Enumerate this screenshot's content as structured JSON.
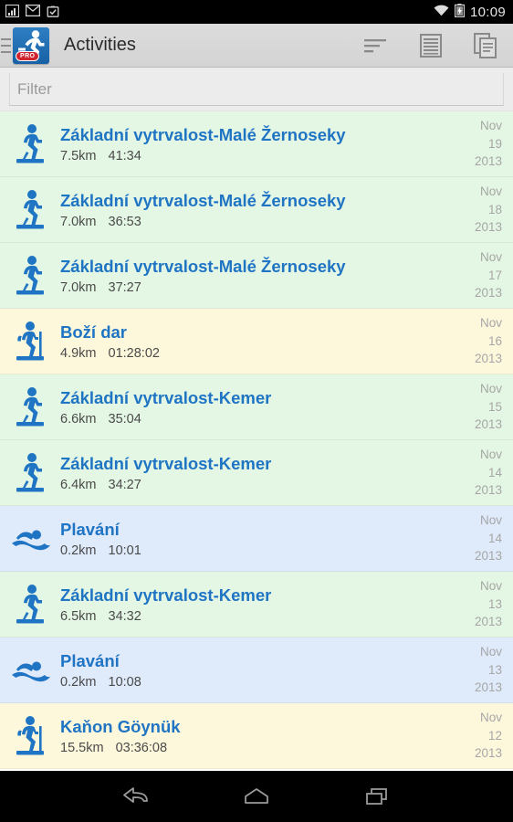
{
  "statusbar": {
    "time": "10:09",
    "left_icons": [
      "signal-bars-icon",
      "gmail-icon",
      "tasks-check-icon"
    ],
    "right_icons": [
      "wifi-icon",
      "battery-charging-icon"
    ]
  },
  "actionbar": {
    "drawer_label": "drawer-handle",
    "app_icon_name": "runtastic-pro-app-icon",
    "pro_badge": "PRO",
    "title": "Activities",
    "actions": [
      {
        "name": "sort-icon",
        "label": "Sort"
      },
      {
        "name": "list-view-icon",
        "label": "List view"
      },
      {
        "name": "copy-pages-icon",
        "label": "Copy"
      }
    ]
  },
  "search": {
    "placeholder": "Filter",
    "value": ""
  },
  "colors": {
    "accent_blue": "#1f74c4",
    "row_green": "#e4f7e4",
    "row_yellow": "#fdf8dc",
    "row_blue": "#dfeafb",
    "date_gray": "#a6a6a6"
  },
  "activities": [
    {
      "icon": "skiing-icon",
      "type": "green",
      "title": "Základní vytrvalost-Malé Žernoseky",
      "distance": "7.5km",
      "duration": "41:34",
      "month": "Nov",
      "day": "19",
      "year": "2013"
    },
    {
      "icon": "skiing-icon",
      "type": "green",
      "title": "Základní vytrvalost-Malé Žernoseky",
      "distance": "7.0km",
      "duration": "36:53",
      "month": "Nov",
      "day": "18",
      "year": "2013"
    },
    {
      "icon": "skiing-icon",
      "type": "green",
      "title": "Základní vytrvalost-Malé Žernoseky",
      "distance": "7.0km",
      "duration": "37:27",
      "month": "Nov",
      "day": "17",
      "year": "2013"
    },
    {
      "icon": "hiking-icon",
      "type": "yellow",
      "title": "Boží dar",
      "distance": "4.9km",
      "duration": "01:28:02",
      "month": "Nov",
      "day": "16",
      "year": "2013"
    },
    {
      "icon": "skiing-icon",
      "type": "green",
      "title": "Základní vytrvalost-Kemer",
      "distance": "6.6km",
      "duration": "35:04",
      "month": "Nov",
      "day": "15",
      "year": "2013"
    },
    {
      "icon": "skiing-icon",
      "type": "green",
      "title": "Základní vytrvalost-Kemer",
      "distance": "6.4km",
      "duration": "34:27",
      "month": "Nov",
      "day": "14",
      "year": "2013"
    },
    {
      "icon": "swimming-icon",
      "type": "blue",
      "title": "Plavání",
      "distance": "0.2km",
      "duration": "10:01",
      "month": "Nov",
      "day": "14",
      "year": "2013"
    },
    {
      "icon": "skiing-icon",
      "type": "green",
      "title": "Základní vytrvalost-Kemer",
      "distance": "6.5km",
      "duration": "34:32",
      "month": "Nov",
      "day": "13",
      "year": "2013"
    },
    {
      "icon": "swimming-icon",
      "type": "blue",
      "title": "Plavání",
      "distance": "0.2km",
      "duration": "10:08",
      "month": "Nov",
      "day": "13",
      "year": "2013"
    },
    {
      "icon": "hiking-icon",
      "type": "yellow",
      "title": "Kaňon Göynük",
      "distance": "15.5km",
      "duration": "03:36:08",
      "month": "Nov",
      "day": "12",
      "year": "2013"
    }
  ],
  "navbar": {
    "buttons": [
      {
        "name": "back-icon",
        "label": "Back"
      },
      {
        "name": "home-icon",
        "label": "Home"
      },
      {
        "name": "recents-icon",
        "label": "Recents"
      }
    ]
  }
}
